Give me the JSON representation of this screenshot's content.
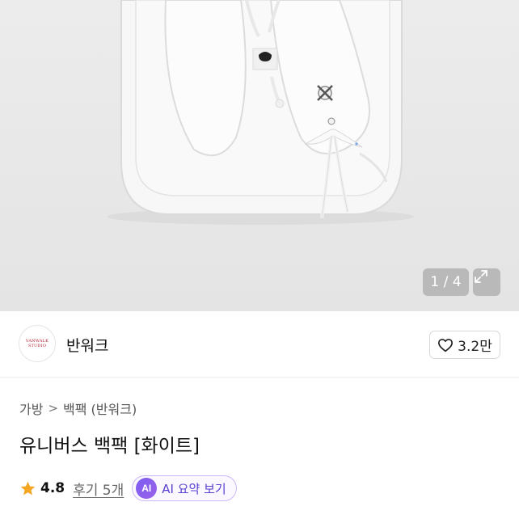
{
  "image": {
    "counter": "1 / 4",
    "icons": {
      "expand": "expand-icon"
    }
  },
  "seller": {
    "name": "반워크",
    "logo_lines": [
      "VANWALK",
      "STUDIO"
    ],
    "likes": "3.2만",
    "icons": {
      "like": "heart-icon"
    }
  },
  "breadcrumb": {
    "level1": "가방",
    "separator": ">",
    "level2": "백팩 (반워크)"
  },
  "product": {
    "title": "유니버스 백팩 [화이트]",
    "rating": "4.8",
    "reviews": "후기 5개",
    "ai_badge": "AI",
    "ai_label": "AI 요약 보기",
    "icons": {
      "rating": "star-icon"
    }
  },
  "colors": {
    "star": "#f5a623",
    "ai_purple": "#6b4fe0",
    "brand_red": "#b0182c"
  }
}
